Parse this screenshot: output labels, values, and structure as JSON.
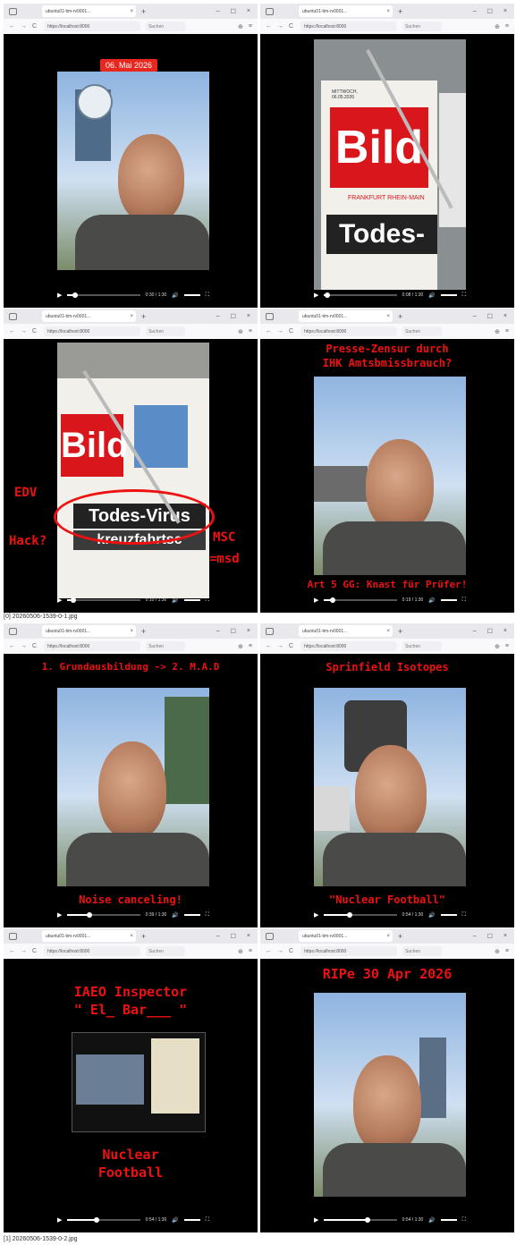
{
  "browser": {
    "tab_title": "ubuntu01-tim-rv0001...",
    "url": "https://localhost:8000",
    "search_placeholder": "Suchen",
    "win_min": "–",
    "win_max": "☐",
    "win_close": "×",
    "tab_new": "+",
    "tab_close": "×",
    "nav_back": "←",
    "nav_forward": "→",
    "nav_reload": "C"
  },
  "sheets": [
    {
      "caption": "[0] 20260506-1539-0-1.jpg",
      "panels": [
        {
          "badge": "06. Mai 2026",
          "time": "0:30 / 1:30",
          "progress": 0.1
        },
        {
          "paper_date": "MITTWOCH, 06.05.2026",
          "logo": "Bild",
          "sub": "FRANKFURT RHEIN-MAIN",
          "headline": "Todes-",
          "time": "0:08 / 1:30",
          "progress": 0.05
        },
        {
          "logo": "Bild",
          "headline": "Todes-Virus",
          "subline": "kreuzfahrtsc",
          "label_edv": "EDV",
          "label_hack": "Hack?",
          "label_msc": "MSC",
          "label_msd": "=msd",
          "time": "0:10 / 1:30",
          "progress": 0.08
        },
        {
          "top_line1": "Presse-Zensur durch",
          "top_line2": "IHK Amtsbmissbrauch?",
          "bottom": "Art 5 GG: Knast für Prüfer!",
          "time": "0:19 / 1:30",
          "progress": 0.12
        }
      ]
    },
    {
      "caption": "[1] 20260506-1539-0-2.jpg",
      "panels": [
        {
          "top": "1. Grundausbildung -> 2. M.A.D",
          "bottom": "Noise canceling!",
          "time": "0:39 / 1:30",
          "progress": 0.3
        },
        {
          "top": "Sprinfield Isotopes",
          "bottom": "\"Nuclear Football\"",
          "time": "0:54 / 1:30",
          "progress": 0.35
        },
        {
          "line1": "IAEO Inspector",
          "line2": "\" El_ Bar___ \"",
          "line3": "Nuclear",
          "line4": "Football",
          "time": "0:54 / 1:30",
          "progress": 0.4
        },
        {
          "top": "RIPe 30 Apr 2026",
          "time": "0:54 / 1:30",
          "progress": 0.6
        }
      ]
    }
  ]
}
